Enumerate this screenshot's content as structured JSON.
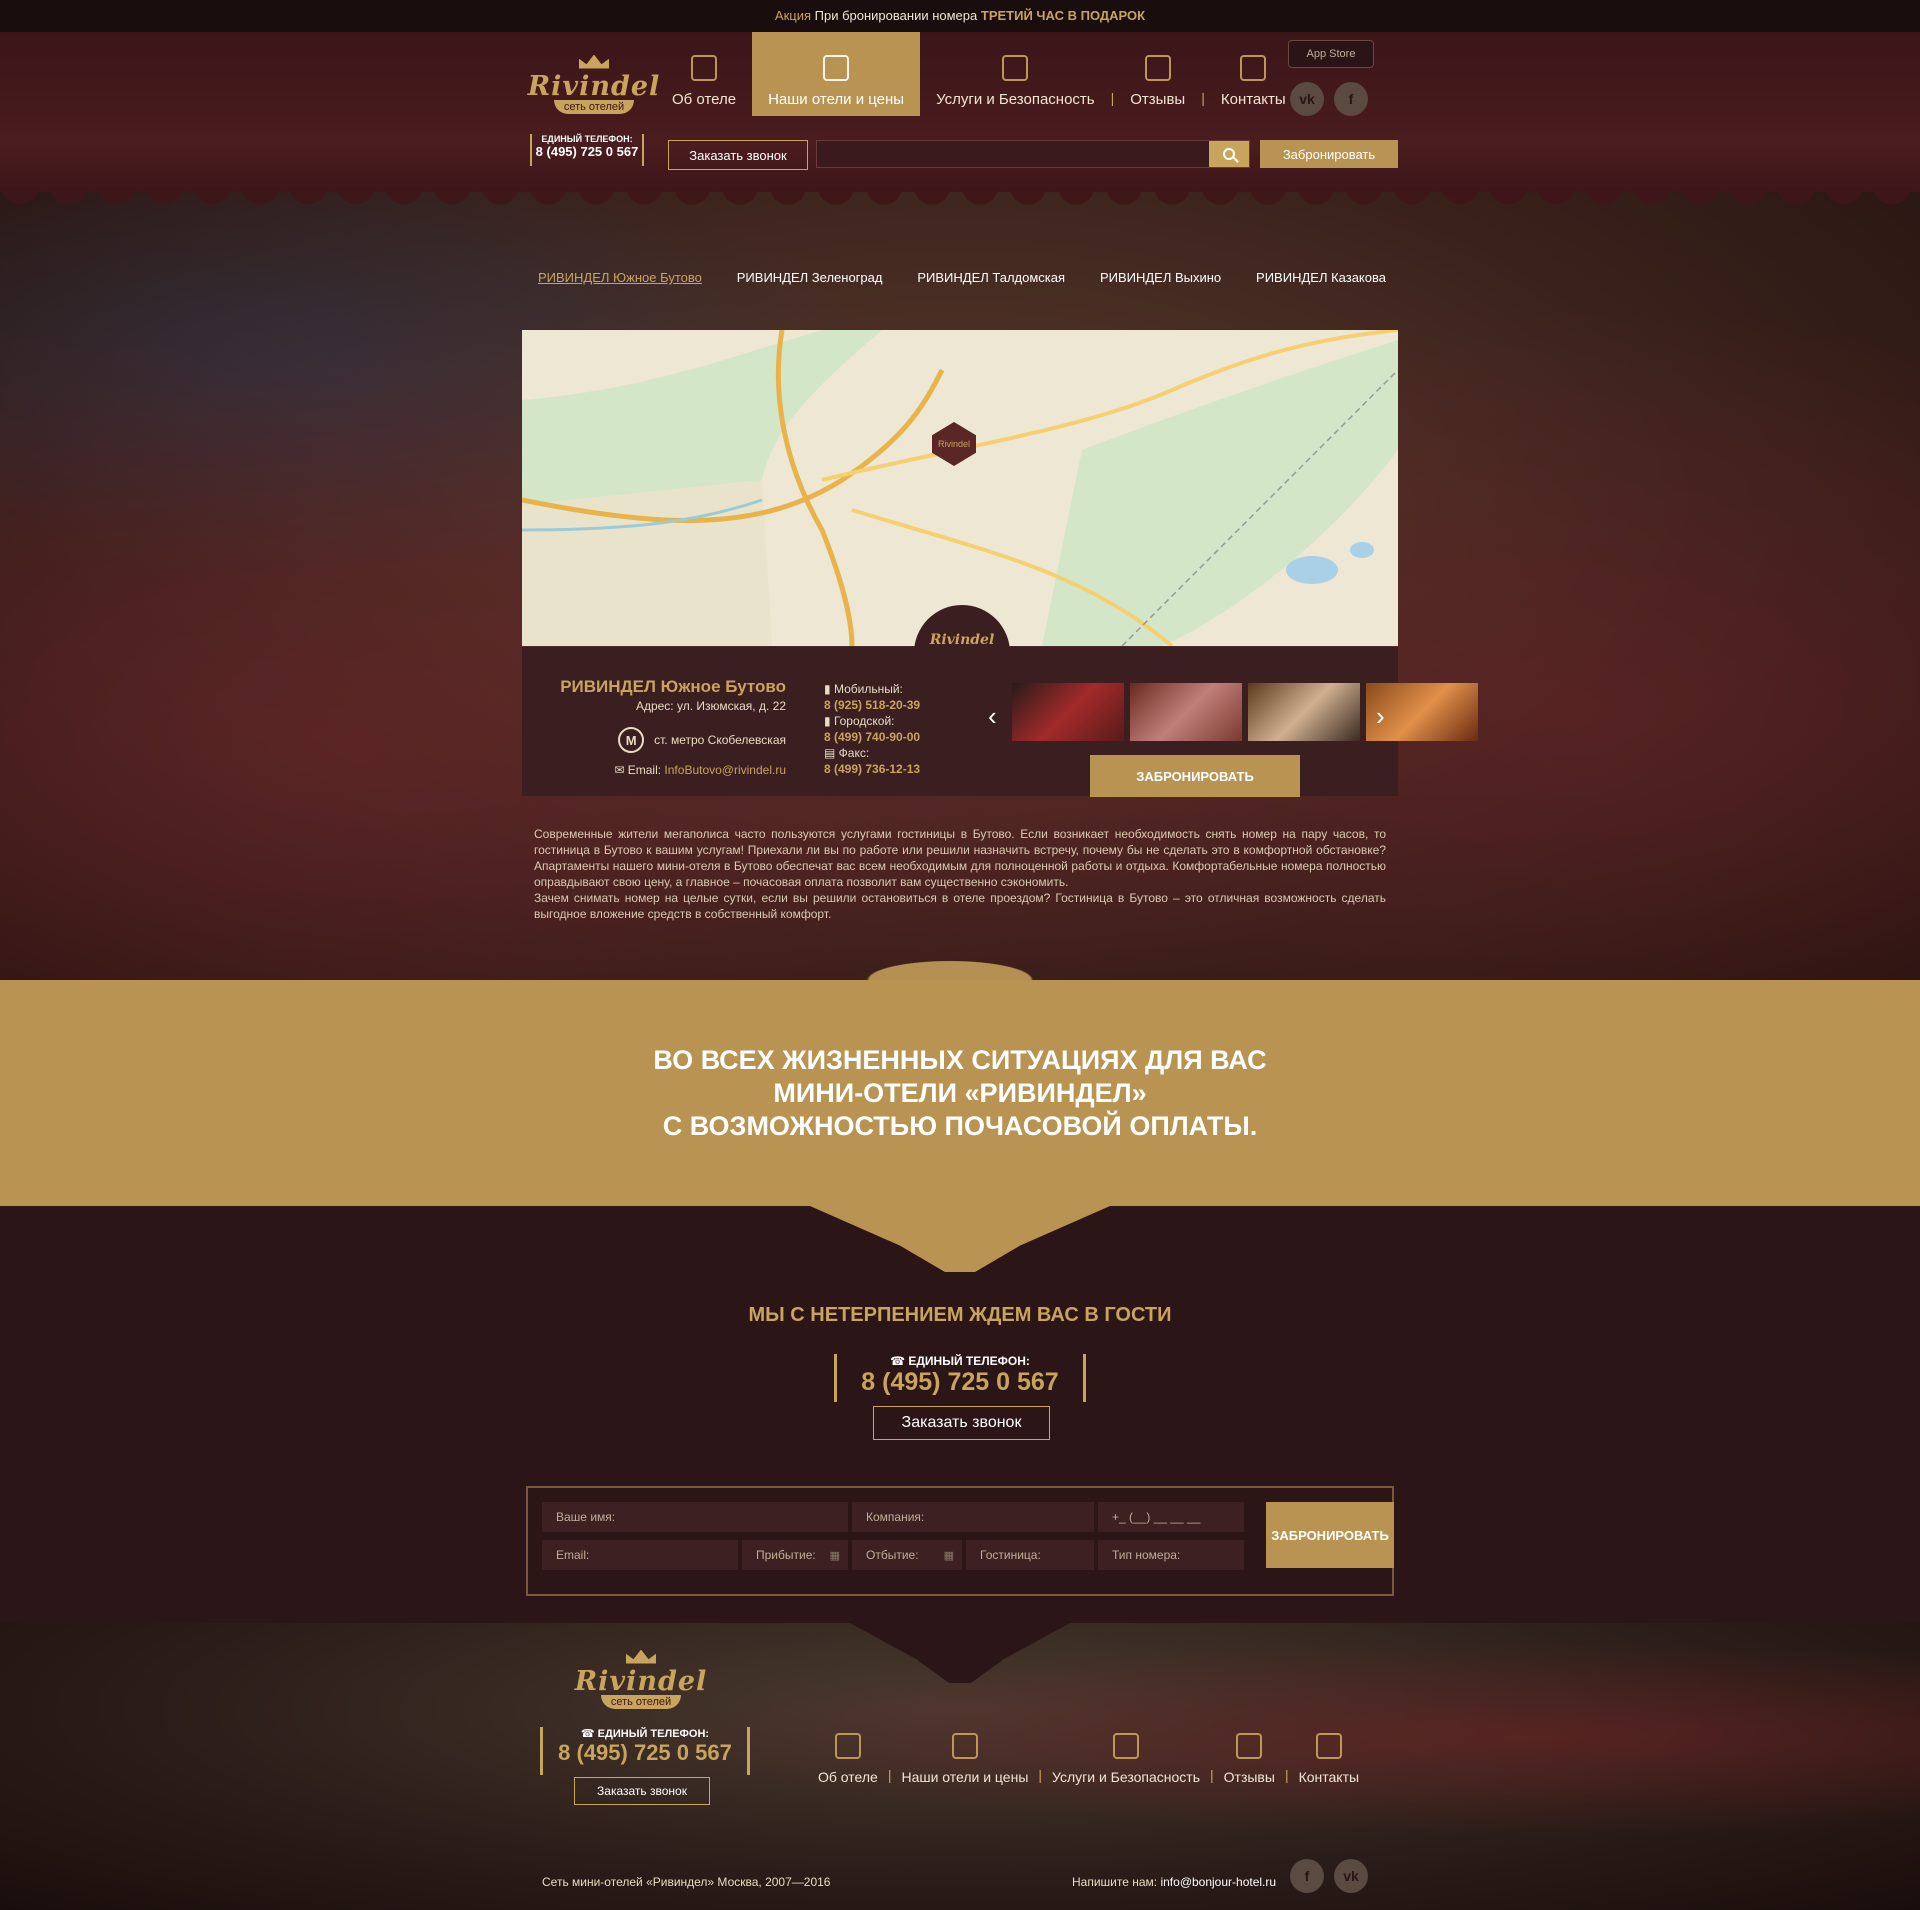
{
  "promo": {
    "label": "Акция",
    "text": "При бронировании номера",
    "highlight": "ТРЕТИЙ ЧАС В ПОДАРОК"
  },
  "brand": {
    "name": "Rivindel",
    "tagline": "сеть отелей"
  },
  "phone": {
    "label": "ЕДИНЫЙ ТЕЛЕФОН:",
    "number": "8 (495) 725 0 567"
  },
  "nav": {
    "items": [
      {
        "label": "Об отеле",
        "icon": "house-icon"
      },
      {
        "label": "Наши отели и цены",
        "icon": "hotel-icon",
        "active": true
      },
      {
        "label": "Услуги и Безопасность",
        "icon": "service-icon"
      },
      {
        "label": "Отзывы",
        "icon": "award-icon"
      },
      {
        "label": "Контакты",
        "icon": "map-icon"
      }
    ],
    "separator": "|"
  },
  "header": {
    "appstore_label": "App Store",
    "social": {
      "vk": "vk",
      "facebook": "f"
    },
    "call_button": "Заказать звонок",
    "book_button": "Забронировать",
    "search_placeholder": ""
  },
  "hotel_tabs": [
    "РИВИНДЕЛ Южное Бутово",
    "РИВИНДЕЛ Зеленоград",
    "РИВИНДЕЛ Талдомская",
    "РИВИНДЕЛ Выхино",
    "РИВИНДЕЛ Казакова"
  ],
  "hotel": {
    "name": "РИВИНДЕЛ Южное Бутово",
    "address": "Адрес: ул. Изюмская, д. 22",
    "metro": "ст. метро Скобелевская",
    "email_label": "Email:",
    "email": "InfoButovo@rivindel.ru",
    "mobile_label": "Мобильный:",
    "mobile": "8 (925) 518-20-39",
    "city_label": "Городской:",
    "city": "8 (499) 740-90-00",
    "fax_label": "Факс:",
    "fax": "8 (499) 736-12-13",
    "book_button": "ЗАБРОНИРОВАТЬ"
  },
  "description": [
    "Современные жители мегаполиса часто пользуются услугами гостиницы в Бутово. Если возникает необходимость снять номер на пару часов, то гостиница в Бутово к вашим услугам! Приехали ли вы по работе или решили назначить встречу, почему бы не сделать это в комфортной обстановке? Апартаменты нашего мини-отеля в Бутово обеспечат вас всем необходимым для полноценной работы и отдыха. Комфортабельные номера полностью оправдывают свою цену, а главное – почасовая оплата позволит вам существенно сэкономить.",
    "Зачем снимать номер на целые сутки, если вы решили остановиться в отеле проездом? Гостиница в Бутово – это отличная возможность сделать выгодное вложение средств в собственный комфорт."
  ],
  "slogan": {
    "line1": "ВО ВСЕХ ЖИЗНЕННЫХ СИТУАЦИЯХ ДЛЯ ВАС",
    "line2": "МИНИ-ОТЕЛИ «РИВИНДЕЛ»",
    "line3": "С ВОЗМОЖНОСТЬЮ ПОЧАСОВОЙ ОПЛАТЫ."
  },
  "welcome": {
    "title": "МЫ С НЕТЕРПЕНИЕМ ЖДЕМ ВАС В ГОСТИ",
    "call_button": "Заказать звонок"
  },
  "form": {
    "name_placeholder": "Ваше имя:",
    "company_placeholder": "Компания:",
    "phone_placeholder": "+_ (__) __ __ __",
    "email_placeholder": "Email:",
    "arrival_placeholder": "Прибытие:",
    "departure_placeholder": "Отбытие:",
    "hotel_placeholder": "Гостиница:",
    "room_placeholder": "Тип номера:",
    "submit": "ЗАБРОНИРОВАТЬ"
  },
  "footer": {
    "call_button": "Заказать звонок",
    "copyright": "Сеть мини-отелей «Ривиндел»  Москва, 2007—2016",
    "write_label": "Напишите нам:",
    "write_email": "info@bonjour-hotel.ru"
  },
  "colors": {
    "gold": "#b89352",
    "dark": "#2b1517",
    "text_gold": "#c9a45c"
  }
}
